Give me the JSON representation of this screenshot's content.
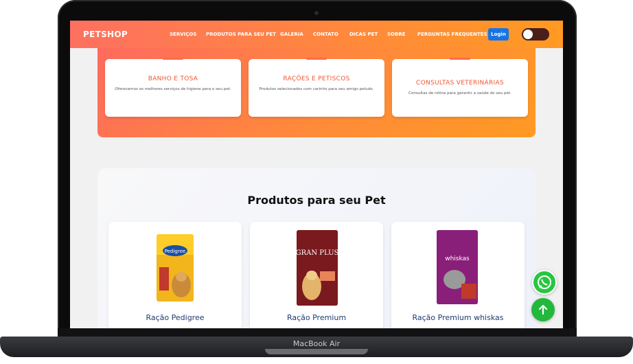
{
  "navbar": {
    "brand": "PETSHOP",
    "links": [
      "SERVIÇOS",
      "PRODUTOS PARA SEU PET",
      "GALERIA",
      "CONTATO",
      "DICAS PET",
      "SOBRE",
      "PERGUNTAS FREQUENTES"
    ],
    "login_label": "Login"
  },
  "services": [
    {
      "title": "BANHO E TOSA",
      "description": "Oferecemos os melhores serviços de higiene para o seu pet."
    },
    {
      "title": "RAÇÕES E PETISCOS",
      "description": "Produtos selecionados com carinho para seu amigo peludo."
    },
    {
      "title": "CONSULTAS VETERINÁRIAS",
      "description": "Consultas de rotina para garantir a saúde do seu pet."
    }
  ],
  "products": {
    "heading": "Produtos para seu Pet",
    "items": [
      {
        "name": "Ração Pedigree",
        "brand_text": "Pedigree",
        "bag_color": "#f2b51c"
      },
      {
        "name": "Ração Premium",
        "brand_text": "GRAN PLUS",
        "bag_color": "#7a1a1e"
      },
      {
        "name": "Ração Premium whiskas",
        "brand_text": "whiskas",
        "bag_color": "#8a1f7a"
      }
    ]
  },
  "device_label": "MacBook Air",
  "colors": {
    "accent": "#ff8a3a",
    "login": "#1774e6",
    "whatsapp": "#28c640"
  },
  "icons": {
    "whatsapp": "whatsapp-icon",
    "back_to_top": "arrow-up-icon"
  }
}
